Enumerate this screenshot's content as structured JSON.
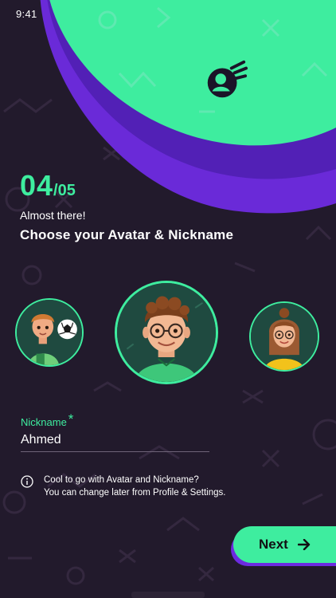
{
  "status_bar": {
    "time": "9:41"
  },
  "progress": {
    "current": "04",
    "total": "/05"
  },
  "header": {
    "subtitle": "Almost there!",
    "title": "Choose your Avatar & Nickname"
  },
  "avatars": [
    {
      "label": "boy-with-football",
      "selected": false
    },
    {
      "label": "boy-with-glasses",
      "selected": true
    },
    {
      "label": "girl-with-glasses",
      "selected": false
    }
  ],
  "nickname": {
    "label": "Nickname",
    "required_mark": "*",
    "value": "Ahmed"
  },
  "info": {
    "line1": "Cool to go with  Avatar and Nickname?",
    "line2": "You can change later from Profile & Settings."
  },
  "next_button": {
    "label": "Next"
  },
  "colors": {
    "background": "#221a2c",
    "accent_green": "#3eed9f",
    "accent_purple": "#6c2be0",
    "text": "#ffffff"
  },
  "icons": {
    "hero": "player-logo-icon",
    "info": "info-icon",
    "next": "arrow-right-icon"
  }
}
